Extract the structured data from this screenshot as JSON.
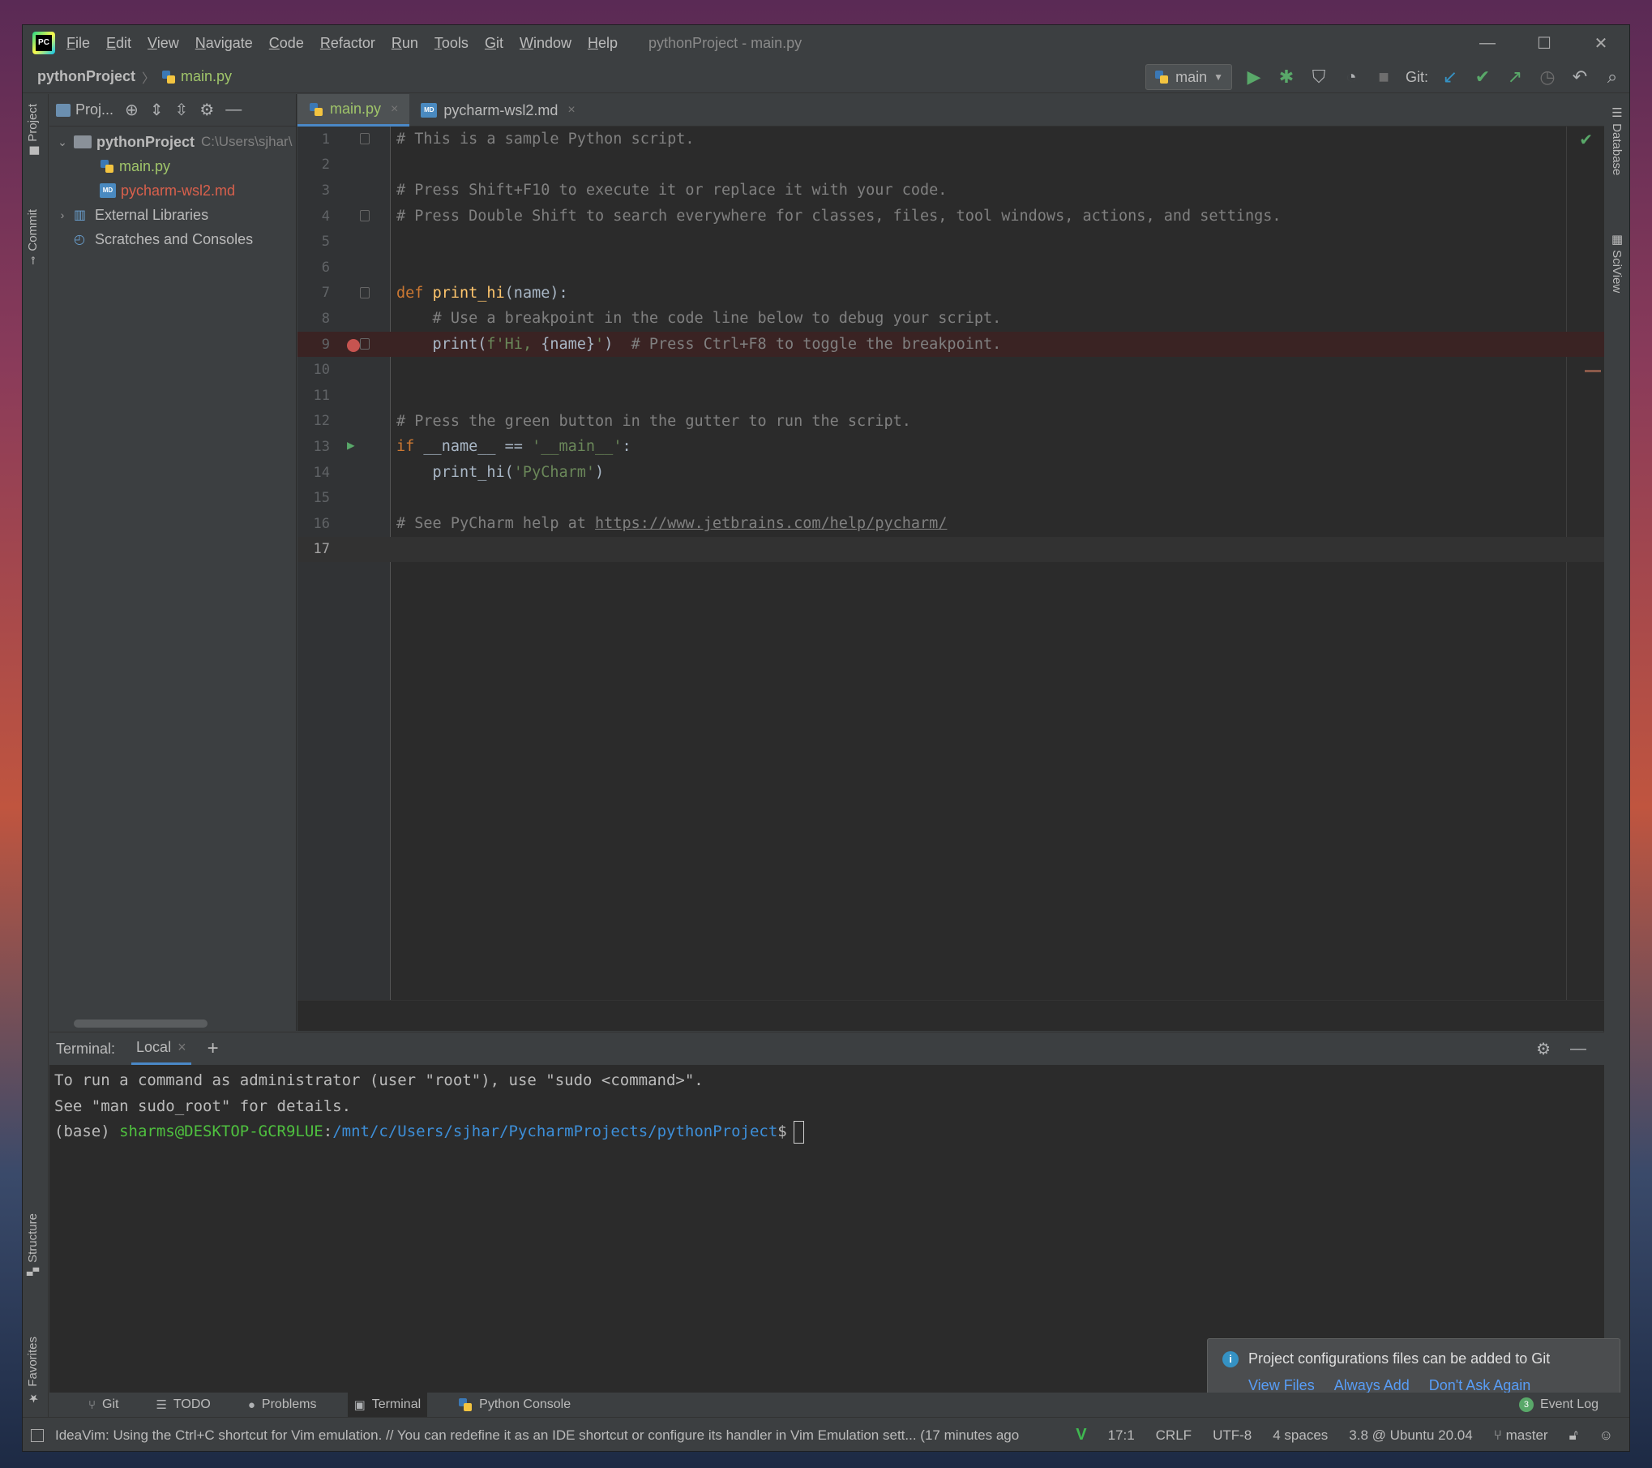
{
  "menu": [
    "File",
    "Edit",
    "View",
    "Navigate",
    "Code",
    "Refactor",
    "Run",
    "Tools",
    "Git",
    "Window",
    "Help"
  ],
  "window_title": "pythonProject - main.py",
  "window_controls": {
    "minimize": "—",
    "maximize": "☐",
    "close": "✕"
  },
  "breadcrumb": {
    "project": "pythonProject",
    "separator": "〉",
    "file": "main.py"
  },
  "toolbar": {
    "run_config": "main",
    "git_label": "Git:"
  },
  "left_strip": {
    "project": "Project",
    "commit": "Commit",
    "structure": "Structure",
    "favorites": "Favorites"
  },
  "right_strip": {
    "database": "Database",
    "sciview": "SciView"
  },
  "project_panel": {
    "header_label": "Proj...",
    "tree": [
      {
        "label": "pythonProject",
        "path": "C:\\Users\\sjhar\\",
        "type": "folder"
      },
      {
        "label": "main.py",
        "type": "python"
      },
      {
        "label": "pycharm-wsl2.md",
        "type": "markdown"
      },
      {
        "label": "External Libraries",
        "type": "library"
      },
      {
        "label": "Scratches and Consoles",
        "type": "scratch"
      }
    ]
  },
  "editor": {
    "tabs": [
      {
        "label": "main.py",
        "close": "×"
      },
      {
        "label": "pycharm-wsl2.md",
        "close": "×"
      }
    ],
    "lines": [
      {
        "n": "1",
        "text": "# This is a sample Python script."
      },
      {
        "n": "2",
        "text": ""
      },
      {
        "n": "3",
        "text": "# Press Shift+F10 to execute it or replace it with your code."
      },
      {
        "n": "4",
        "text": "# Press Double Shift to search everywhere for classes, files, tool windows, actions, and settings."
      },
      {
        "n": "5",
        "text": ""
      },
      {
        "n": "6",
        "text": ""
      },
      {
        "n": "7",
        "kw": "def ",
        "fn": "print_hi",
        "rest": "(name):"
      },
      {
        "n": "8",
        "text": "    # Use a breakpoint in the code line below to debug your script."
      },
      {
        "n": "9",
        "pre": "    print(",
        "str1": "f'Hi, ",
        "mid": "{name}",
        "str2": "'",
        "post": ")  ",
        "comment": "# Press Ctrl+F8 to toggle the breakpoint."
      },
      {
        "n": "10",
        "text": ""
      },
      {
        "n": "11",
        "text": ""
      },
      {
        "n": "12",
        "text": "# Press the green button in the gutter to run the script."
      },
      {
        "n": "13",
        "kw": "if ",
        "rest": "__name__ == ",
        "str": "'__main__'",
        "post": ":"
      },
      {
        "n": "14",
        "pre": "    print_hi(",
        "str": "'PyCharm'",
        "post": ")"
      },
      {
        "n": "15",
        "text": ""
      },
      {
        "n": "16",
        "comment": "# See PyCharm help at ",
        "link": "https://www.jetbrains.com/help/pycharm/"
      },
      {
        "n": "17",
        "text": ""
      }
    ]
  },
  "terminal": {
    "label": "Terminal:",
    "tab": "Local",
    "tab_close": "×",
    "add": "+",
    "lines": [
      "To run a command as administrator (user \"root\"), use \"sudo <command>\".",
      "See \"man sudo_root\" for details."
    ],
    "prompt_prefix": "(base) ",
    "prompt_user": "sharms@DESKTOP-GCR9LUE",
    "prompt_colon": ":",
    "prompt_path": "/mnt/c/Users/sjhar/PycharmProjects/pythonProject",
    "prompt_suffix": "$"
  },
  "notification": {
    "message": "Project configurations files can be added to Git",
    "actions": [
      "View Files",
      "Always Add",
      "Don't Ask Again"
    ]
  },
  "bottom_tabs": [
    "Git",
    "TODO",
    "Problems",
    "Terminal",
    "Python Console"
  ],
  "event_log": {
    "count": "3",
    "label": "Event Log"
  },
  "status": {
    "message": "IdeaVim: Using the Ctrl+C shortcut for Vim emulation. // You can redefine it as an IDE shortcut or configure its handler in Vim Emulation sett... (17 minutes ago",
    "position": "17:1",
    "line_sep": "CRLF",
    "encoding": "UTF-8",
    "indent": "4 spaces",
    "interpreter": "3.8 @ Ubuntu 20.04",
    "branch": "master"
  },
  "colors": {
    "accent": "#4a88c7",
    "run_green": "#59a869",
    "breakpoint": "#c75450",
    "link": "#589df6"
  }
}
